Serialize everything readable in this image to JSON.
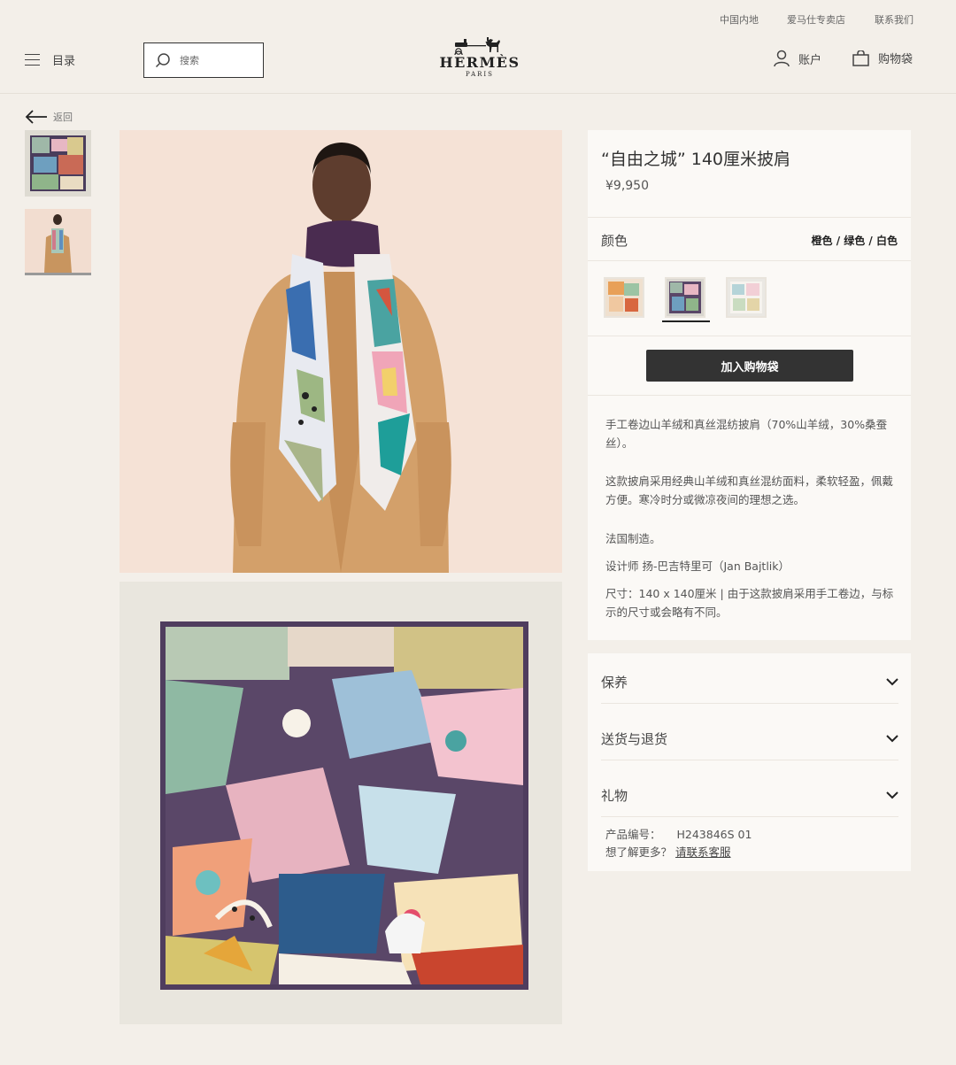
{
  "header": {
    "util_links": [
      "中国内地",
      "爱马仕专卖店",
      "联系我们"
    ],
    "menu_label": "目录",
    "search_placeholder": "搜索",
    "logo_main": "HERMÈS",
    "logo_sub": "PARIS",
    "account_label": "账户",
    "bag_label": "购物袋"
  },
  "back_label": "返回",
  "product": {
    "title": "“自由之城” 140厘米披肩",
    "price": "¥9,950",
    "color_label": "颜色",
    "color_value": "橙色 / 绿色 / 白色",
    "swatches": [
      "orange-variant",
      "green-variant",
      "white-variant"
    ],
    "selected_swatch": 1,
    "add_to_bag_label": "加入购物袋",
    "description": {
      "p1": "手工卷边山羊绒和真丝混纺披肩（70%山羊绒，30%桑蚕丝）。",
      "p2": "这款披肩采用经典山羊绒和真丝混纺面料，柔软轻盈，佩戴方便。寒冷时分或微凉夜间的理想之选。",
      "p3": "法国制造。",
      "p4": "设计师 扬-巴吉特里可（Jan Bajtlik）",
      "p5": "尺寸：140 x 140厘米 | 由于这款披肩采用手工卷边，与标示的尺寸或会略有不同。"
    }
  },
  "accordion": {
    "care": "保养",
    "delivery": "送货与退货",
    "gift": "礼物"
  },
  "meta": {
    "sku_label": "产品编号：",
    "sku_value": "H243846S 01",
    "more_label": "想了解更多？",
    "contact_link": "请联系客服"
  },
  "colors": {
    "background": "#f3efe9",
    "panel": "#fbf9f6",
    "button": "#333333"
  },
  "icons": [
    "menu-icon",
    "search-icon",
    "account-icon",
    "bag-icon",
    "back-arrow-icon",
    "chevron-down-icon"
  ]
}
